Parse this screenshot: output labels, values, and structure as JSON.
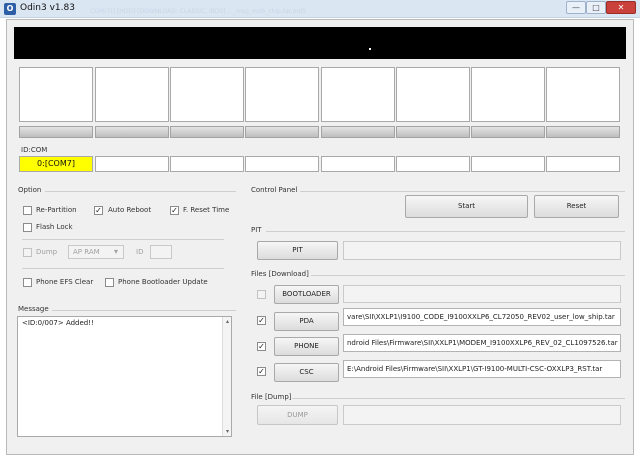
{
  "window": {
    "title": "Odin3 v1.83",
    "background_text": "COM(7)] [HDD]  [DOWNLOAD: CLASSIC, IBD0] ..._msg_mob_chip.tar.md5",
    "controls": {
      "minimize": "—",
      "maximize": "□",
      "close": "✕"
    }
  },
  "slots": {
    "id_com_label": "ID:COM",
    "com_ports": [
      "0:[COM7]",
      "",
      "",
      "",
      "",
      "",
      "",
      ""
    ]
  },
  "option": {
    "title": "Option",
    "re_partition": "Re-Partition",
    "auto_reboot": "Auto Reboot",
    "f_reset_time": "F. Reset Time",
    "flash_lock": "Flash Lock",
    "dump": "Dump",
    "dump_select": "AP RAM",
    "id_label": "ID",
    "phone_efs_clear": "Phone EFS Clear",
    "phone_bootloader_update": "Phone Bootloader Update"
  },
  "message": {
    "title": "Message",
    "log": "<ID:0/007> Added!!"
  },
  "control_panel": {
    "title": "Control Panel",
    "start": "Start",
    "reset": "Reset"
  },
  "pit": {
    "title": "PIT",
    "button": "PIT",
    "path": ""
  },
  "files": {
    "title": "Files [Download]",
    "bootloader": {
      "label": "BOOTLOADER",
      "path": ""
    },
    "pda": {
      "label": "PDA",
      "path": "vare\\SII\\XXLP1\\I9100_CODE_I9100XXLP6_CL72050_REV02_user_low_ship.tar"
    },
    "phone": {
      "label": "PHONE",
      "path": "ndroid Files\\Firmware\\SII\\XXLP1\\MODEM_I9100XXLP6_REV_02_CL1097526.tar"
    },
    "csc": {
      "label": "CSC",
      "path": "E:\\Android Files\\Firmware\\SII\\XXLP1\\GT-I9100-MULTI-CSC-OXXLP3_RST.tar"
    }
  },
  "file_dump": {
    "title": "File [Dump]",
    "button": "DUMP",
    "path": ""
  },
  "glyphs": {
    "check": "✓",
    "arrow_down": "▾",
    "arrow_up": "▴"
  }
}
